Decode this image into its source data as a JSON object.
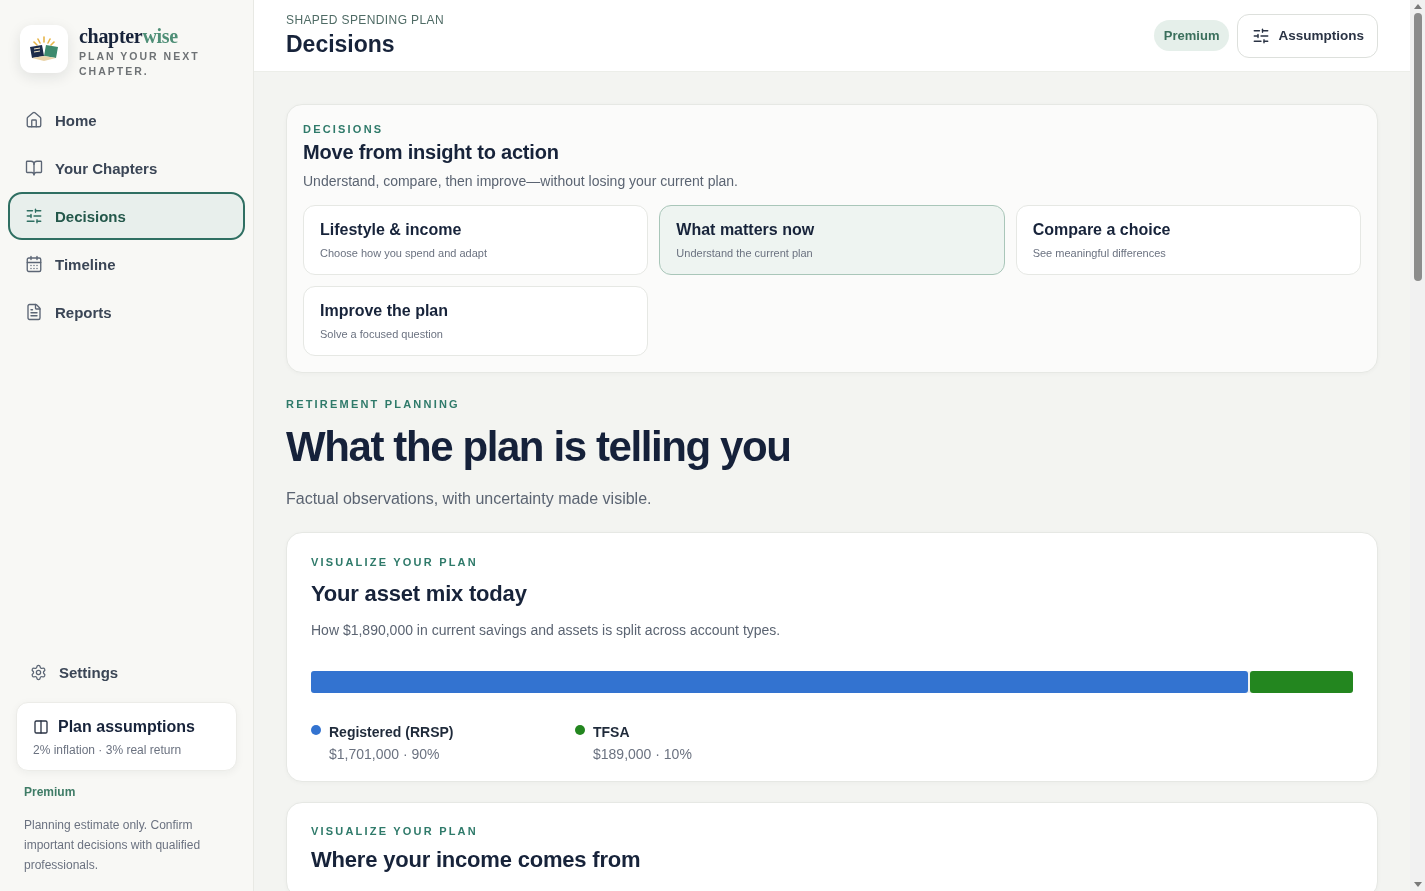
{
  "sidebar": {
    "brand": {
      "name_parts": [
        {
          "text": "chapter",
          "accent": false
        },
        {
          "text": "wise",
          "accent": true
        }
      ],
      "tagline": "PLAN YOUR NEXT CHAPTER."
    },
    "nav": [
      {
        "label": "Home",
        "selected": false
      },
      {
        "label": "Your Chapters",
        "selected": false
      },
      {
        "label": "Decisions",
        "selected": true
      },
      {
        "label": "Timeline",
        "selected": false
      },
      {
        "label": "Reports",
        "selected": false
      }
    ],
    "settings": {
      "label": "Settings"
    },
    "assumptions_card": {
      "title": "Plan assumptions",
      "summary": "2% inflation · 3% real return"
    },
    "plan_tier": "Premium",
    "disclaimer": "Planning estimate only. Confirm important decisions with qualified professionals."
  },
  "header": {
    "eyebrow": "SHAPED SPENDING PLAN",
    "title": "Decisions",
    "badge": "Premium",
    "button": "Assumptions"
  },
  "decisions_card": {
    "eyebrow": "DECISIONS",
    "title": "Move from insight to action",
    "subtitle": "Understand, compare, then improve—without losing your current plan.",
    "options": [
      {
        "title": "Lifestyle & income",
        "subtitle": "Choose how you spend and adapt",
        "selected": false
      },
      {
        "title": "What matters now",
        "subtitle": "Understand the current plan",
        "selected": true
      },
      {
        "title": "Compare a choice",
        "subtitle": "See meaningful differences",
        "selected": false
      },
      {
        "title": "Improve the plan",
        "subtitle": "Solve a focused question",
        "selected": false
      }
    ]
  },
  "section": {
    "eyebrow": "RETIREMENT PLANNING",
    "title": "What the plan is telling you",
    "subtitle": "Factual observations, with uncertainty made visible."
  },
  "asset_mix_card": {
    "eyebrow": "VISUALIZE YOUR PLAN",
    "title": "Your asset mix today",
    "description": "How $1,890,000 in current savings and assets is split across account types.",
    "segments": [
      {
        "label": "Registered (RRSP)",
        "detail": "$1,701,000 · 90%",
        "color": "#3373d0",
        "level": 0.9
      },
      {
        "label": "TFSA",
        "detail": "$189,000 · 10%",
        "color": "#23861f",
        "level": 0.1
      }
    ]
  },
  "income_card": {
    "eyebrow": "VISUALIZE YOUR PLAN",
    "title": "Where your income comes from"
  }
}
